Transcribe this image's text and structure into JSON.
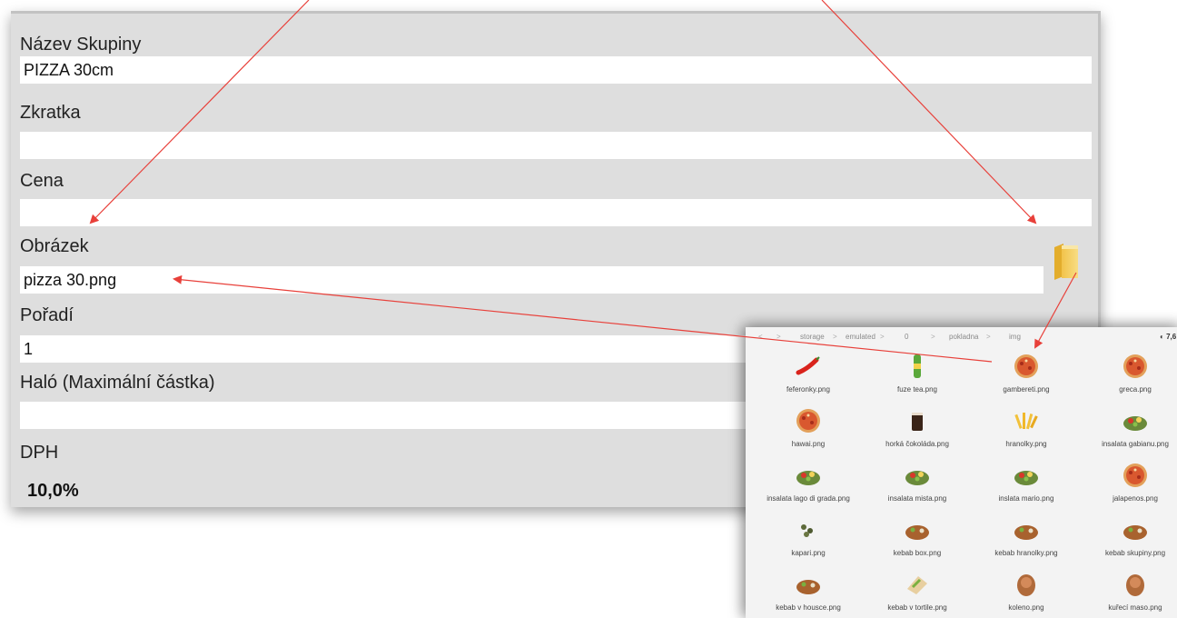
{
  "form": {
    "fields": [
      {
        "label": "Název Skupiny",
        "value": "PIZZA 30cm"
      },
      {
        "label": "Zkratka",
        "value": ""
      },
      {
        "label": "Cena",
        "value": ""
      },
      {
        "label": "Obrázek",
        "value": "pizza 30.png"
      },
      {
        "label": "Pořadí",
        "value": "1"
      },
      {
        "label": "Haló (Maximální částka)",
        "value": ""
      }
    ],
    "dph_label": "DPH",
    "dph_value": "10,0%",
    "folder_icon": "folder-icon"
  },
  "file_browser": {
    "breadcrumbs": [
      "storage",
      "emulated",
      "0",
      "pokladna",
      "img"
    ],
    "storage_indicator": "7,6",
    "files": [
      {
        "name": "feferonky.png",
        "icon": "chili"
      },
      {
        "name": "fuze tea.png",
        "icon": "drink"
      },
      {
        "name": "gambereti.png",
        "icon": "pizza"
      },
      {
        "name": "greca.png",
        "icon": "pizza"
      },
      {
        "name": "hawai.png",
        "icon": "pizza"
      },
      {
        "name": "horká čokoláda.png",
        "icon": "cup"
      },
      {
        "name": "hranolky.png",
        "icon": "fries"
      },
      {
        "name": "insalata gabianu.png",
        "icon": "salad"
      },
      {
        "name": "insalata lago di grada.png",
        "icon": "salad"
      },
      {
        "name": "insalata mista.png",
        "icon": "salad"
      },
      {
        "name": "inslata mario.png",
        "icon": "salad"
      },
      {
        "name": "jalapenos.png",
        "icon": "pizza"
      },
      {
        "name": "kapari.png",
        "icon": "capers"
      },
      {
        "name": "kebab box.png",
        "icon": "kebab"
      },
      {
        "name": "kebab hranolky.png",
        "icon": "kebab"
      },
      {
        "name": "kebab skupiny.png",
        "icon": "kebab"
      },
      {
        "name": "kebab v housce.png",
        "icon": "kebab"
      },
      {
        "name": "kebab v tortile.png",
        "icon": "wrap"
      },
      {
        "name": "koleno.png",
        "icon": "meat"
      },
      {
        "name": "kuřecí maso.png",
        "icon": "meat"
      }
    ]
  },
  "colors": {
    "panel_bg": "#dedede",
    "input_bg": "#ffffff",
    "arrow": "#e8403a",
    "browser_bg": "#f3f3f3"
  }
}
